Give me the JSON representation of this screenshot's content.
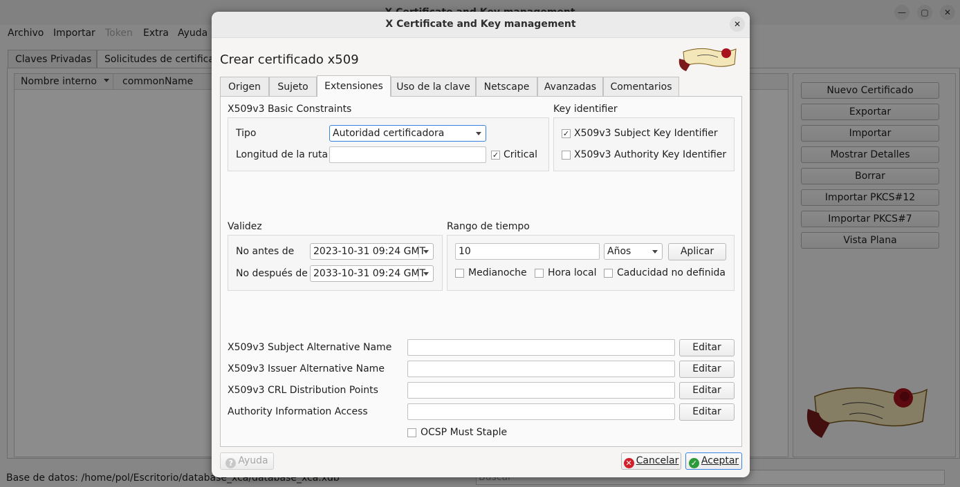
{
  "main": {
    "title": "X Certificate and Key management",
    "menu": [
      "Archivo",
      "Importar",
      "Token",
      "Extra",
      "Ayuda"
    ],
    "tabs": [
      "Claves Privadas",
      "Solicitudes de certificado"
    ],
    "columns": [
      "Nombre interno",
      "commonName"
    ],
    "side_buttons": [
      "Nuevo Certificado",
      "Exportar",
      "Importar",
      "Mostrar Detalles",
      "Borrar",
      "Importar PKCS#12",
      "Importar PKCS#7",
      "Vista Plana"
    ],
    "status": "Base de datos: /home/pol/Escritorio/database_xca/database_xca.xdb",
    "search_placeholder": "Buscar"
  },
  "dialog": {
    "title": "X Certificate and Key management",
    "heading": "Crear certificado x509",
    "tabs": [
      "Origen",
      "Sujeto",
      "Extensiones",
      "Uso de la clave",
      "Netscape",
      "Avanzadas",
      "Comentarios"
    ],
    "active_tab": "Extensiones",
    "basic_constraints": {
      "title": "X509v3 Basic Constraints",
      "tipo_label": "Tipo",
      "tipo_value": "Autoridad certificadora",
      "path_label": "Longitud de la ruta",
      "path_value": "",
      "critical_label": "Critical",
      "critical_checked": true
    },
    "key_identifier": {
      "title": "Key identifier",
      "subject_label": "X509v3 Subject Key Identifier",
      "subject_checked": true,
      "authority_label": "X509v3 Authority Key Identifier",
      "authority_checked": false
    },
    "validity": {
      "title": "Validez",
      "not_before_label": "No antes de",
      "not_before_value": "2023-10-31 09:24 GMT",
      "not_after_label": "No después de",
      "not_after_value": "2033-10-31 09:24 GMT"
    },
    "time_range": {
      "title": "Rango de tiempo",
      "value": "10",
      "unit": "Años",
      "apply": "Aplicar",
      "midnight": "Medianoche",
      "local_time": "Hora local",
      "no_expiry": "Caducidad no definida"
    },
    "alt_names": [
      {
        "label": "X509v3 Subject Alternative Name",
        "value": "",
        "button": "Editar"
      },
      {
        "label": "X509v3 Issuer Alternative Name",
        "value": "",
        "button": "Editar"
      },
      {
        "label": "X509v3 CRL Distribution Points",
        "value": "",
        "button": "Editar"
      },
      {
        "label": "Authority Information Access",
        "value": "",
        "button": "Editar"
      }
    ],
    "ocsp_label": "OCSP Must Staple",
    "buttons": {
      "help": "Ayuda",
      "cancel": "Cancelar",
      "accept": "Aceptar"
    }
  },
  "colors": {
    "accent": "#3584e4",
    "cancel_icon": "#d0202a",
    "accept_icon": "#2d9a3a",
    "logo_red": "#a8121e"
  }
}
